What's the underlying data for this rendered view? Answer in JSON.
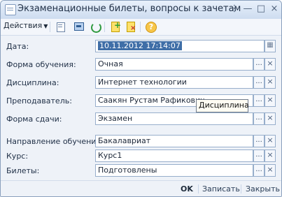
{
  "window": {
    "title": "Экзаменационные билеты, вопросы к зачетам",
    "controls": {
      "menu": "⋮",
      "minimize": "—",
      "maximize": "□",
      "close": "×"
    }
  },
  "toolbar": {
    "actions_label": "Действия",
    "help_label": "?"
  },
  "form": {
    "date": {
      "label": "Дата:",
      "value": "10.11.2012 17:14:07"
    },
    "study_form": {
      "label": "Форма обучения:",
      "value": "Очная"
    },
    "discipline": {
      "label": "Дисциплина:",
      "value": "Интернет технологии"
    },
    "teacher": {
      "label": "Преподаватель:",
      "value": "Саакян Рустам Рафикович"
    },
    "exam_form": {
      "label": "Форма сдачи:",
      "value": "Экзамен"
    },
    "direction": {
      "label": "Направление обучения:",
      "value": "Бакалавриат"
    },
    "course": {
      "label": "Курс:",
      "value": "Курс1"
    },
    "tickets": {
      "label": "Билеты:",
      "value": "Подготовлены"
    },
    "tooltip": "Дисциплина",
    "ellipsis": "...",
    "clear": "×"
  },
  "footer": {
    "ok": "OK",
    "save": "Записать",
    "close": "Закрыть"
  },
  "colors": {
    "accent": "#3f6ea7",
    "window_bg": "#eef2f8",
    "border": "#8aa0bd"
  }
}
